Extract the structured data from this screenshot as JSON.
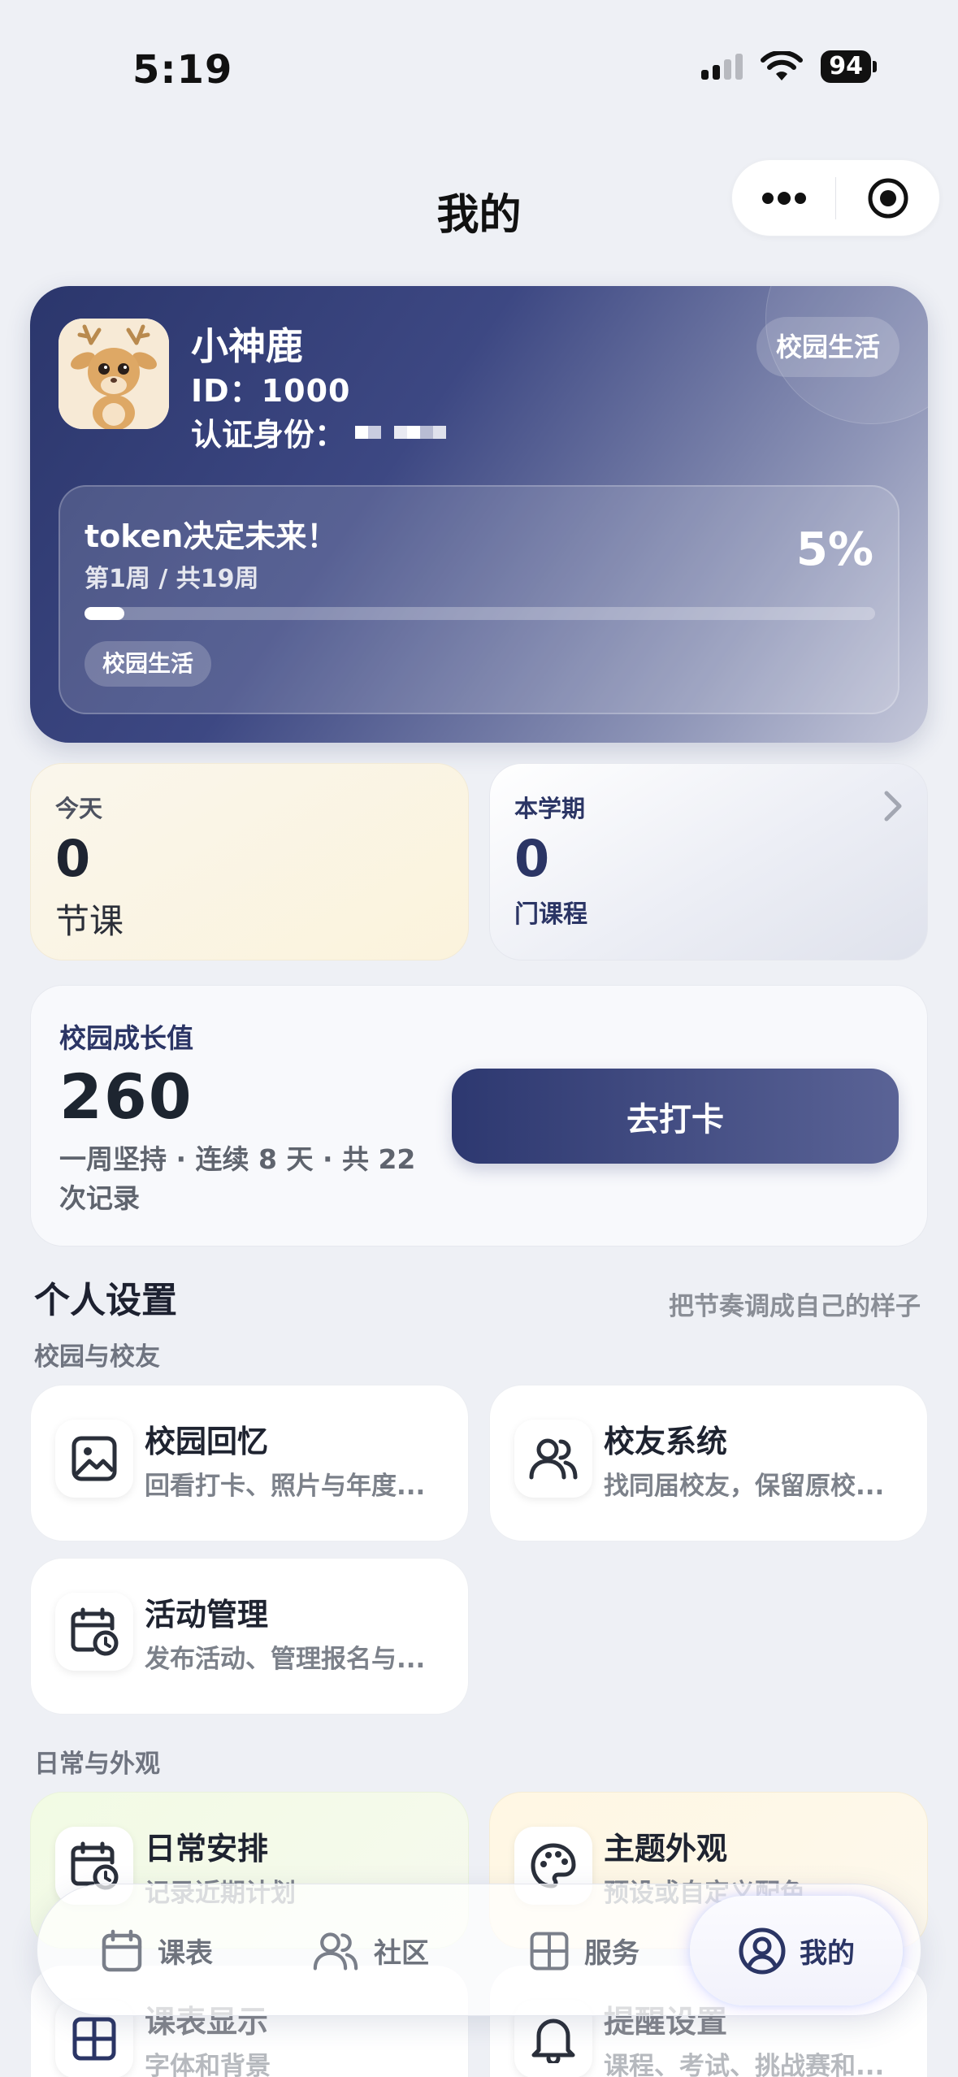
{
  "status_bar": {
    "time": "5:19",
    "battery": "94"
  },
  "header": {
    "title": "我的",
    "capsule_icons": [
      "more-dots-icon",
      "record-target-icon"
    ]
  },
  "profile": {
    "name": "小神鹿",
    "id": "ID：1000",
    "cert_label": "认证身份：",
    "badge": "校园生活",
    "plan": {
      "title": "token决定未来！",
      "week": "第1周 / 共19周",
      "percent": "5%",
      "progress_fraction": 0.05,
      "tag": "校园生活"
    }
  },
  "stats": {
    "today": {
      "label": "今天",
      "value": "0",
      "unit": "节课"
    },
    "semester": {
      "label": "本学期",
      "value": "0",
      "unit": "门课程"
    }
  },
  "growth": {
    "label": "校园成长值",
    "value": "260",
    "desc": "一周坚持 · 连续 8 天 · 共 22 次记录",
    "button": "去打卡"
  },
  "settings": {
    "title": "个人设置",
    "hint": "把节奏调成自己的样子",
    "groups": [
      {
        "label": "校园与校友",
        "items": [
          {
            "title": "校园回忆",
            "sub": "回看打卡、照片与年度...",
            "icon": "image-icon"
          },
          {
            "title": "校友系统",
            "sub": "找同届校友，保留原校...",
            "icon": "users-icon"
          },
          {
            "title": "活动管理",
            "sub": "发布活动、管理报名与...",
            "icon": "calendar-clock-icon"
          }
        ]
      },
      {
        "label": "日常与外观",
        "items": [
          {
            "title": "日常安排",
            "sub": "记录近期计划",
            "icon": "calendar-clock-icon"
          },
          {
            "title": "主题外观",
            "sub": "预设或自定义配色",
            "icon": "palette-icon"
          },
          {
            "title": "课表显示",
            "sub": "字体和背景",
            "icon": "grid-icon"
          },
          {
            "title": "提醒设置",
            "sub": "课程、考试、挑战赛和...",
            "icon": "bell-icon"
          }
        ]
      }
    ]
  },
  "tabbar": {
    "items": [
      {
        "label": "课表",
        "icon": "calendar-icon"
      },
      {
        "label": "社区",
        "icon": "users-icon"
      },
      {
        "label": "服务",
        "icon": "grid-icon"
      },
      {
        "label": "我的",
        "icon": "user-circle-icon",
        "active": true
      }
    ]
  },
  "colors": {
    "brand": "#2b3565",
    "background": "#eef0f5"
  }
}
